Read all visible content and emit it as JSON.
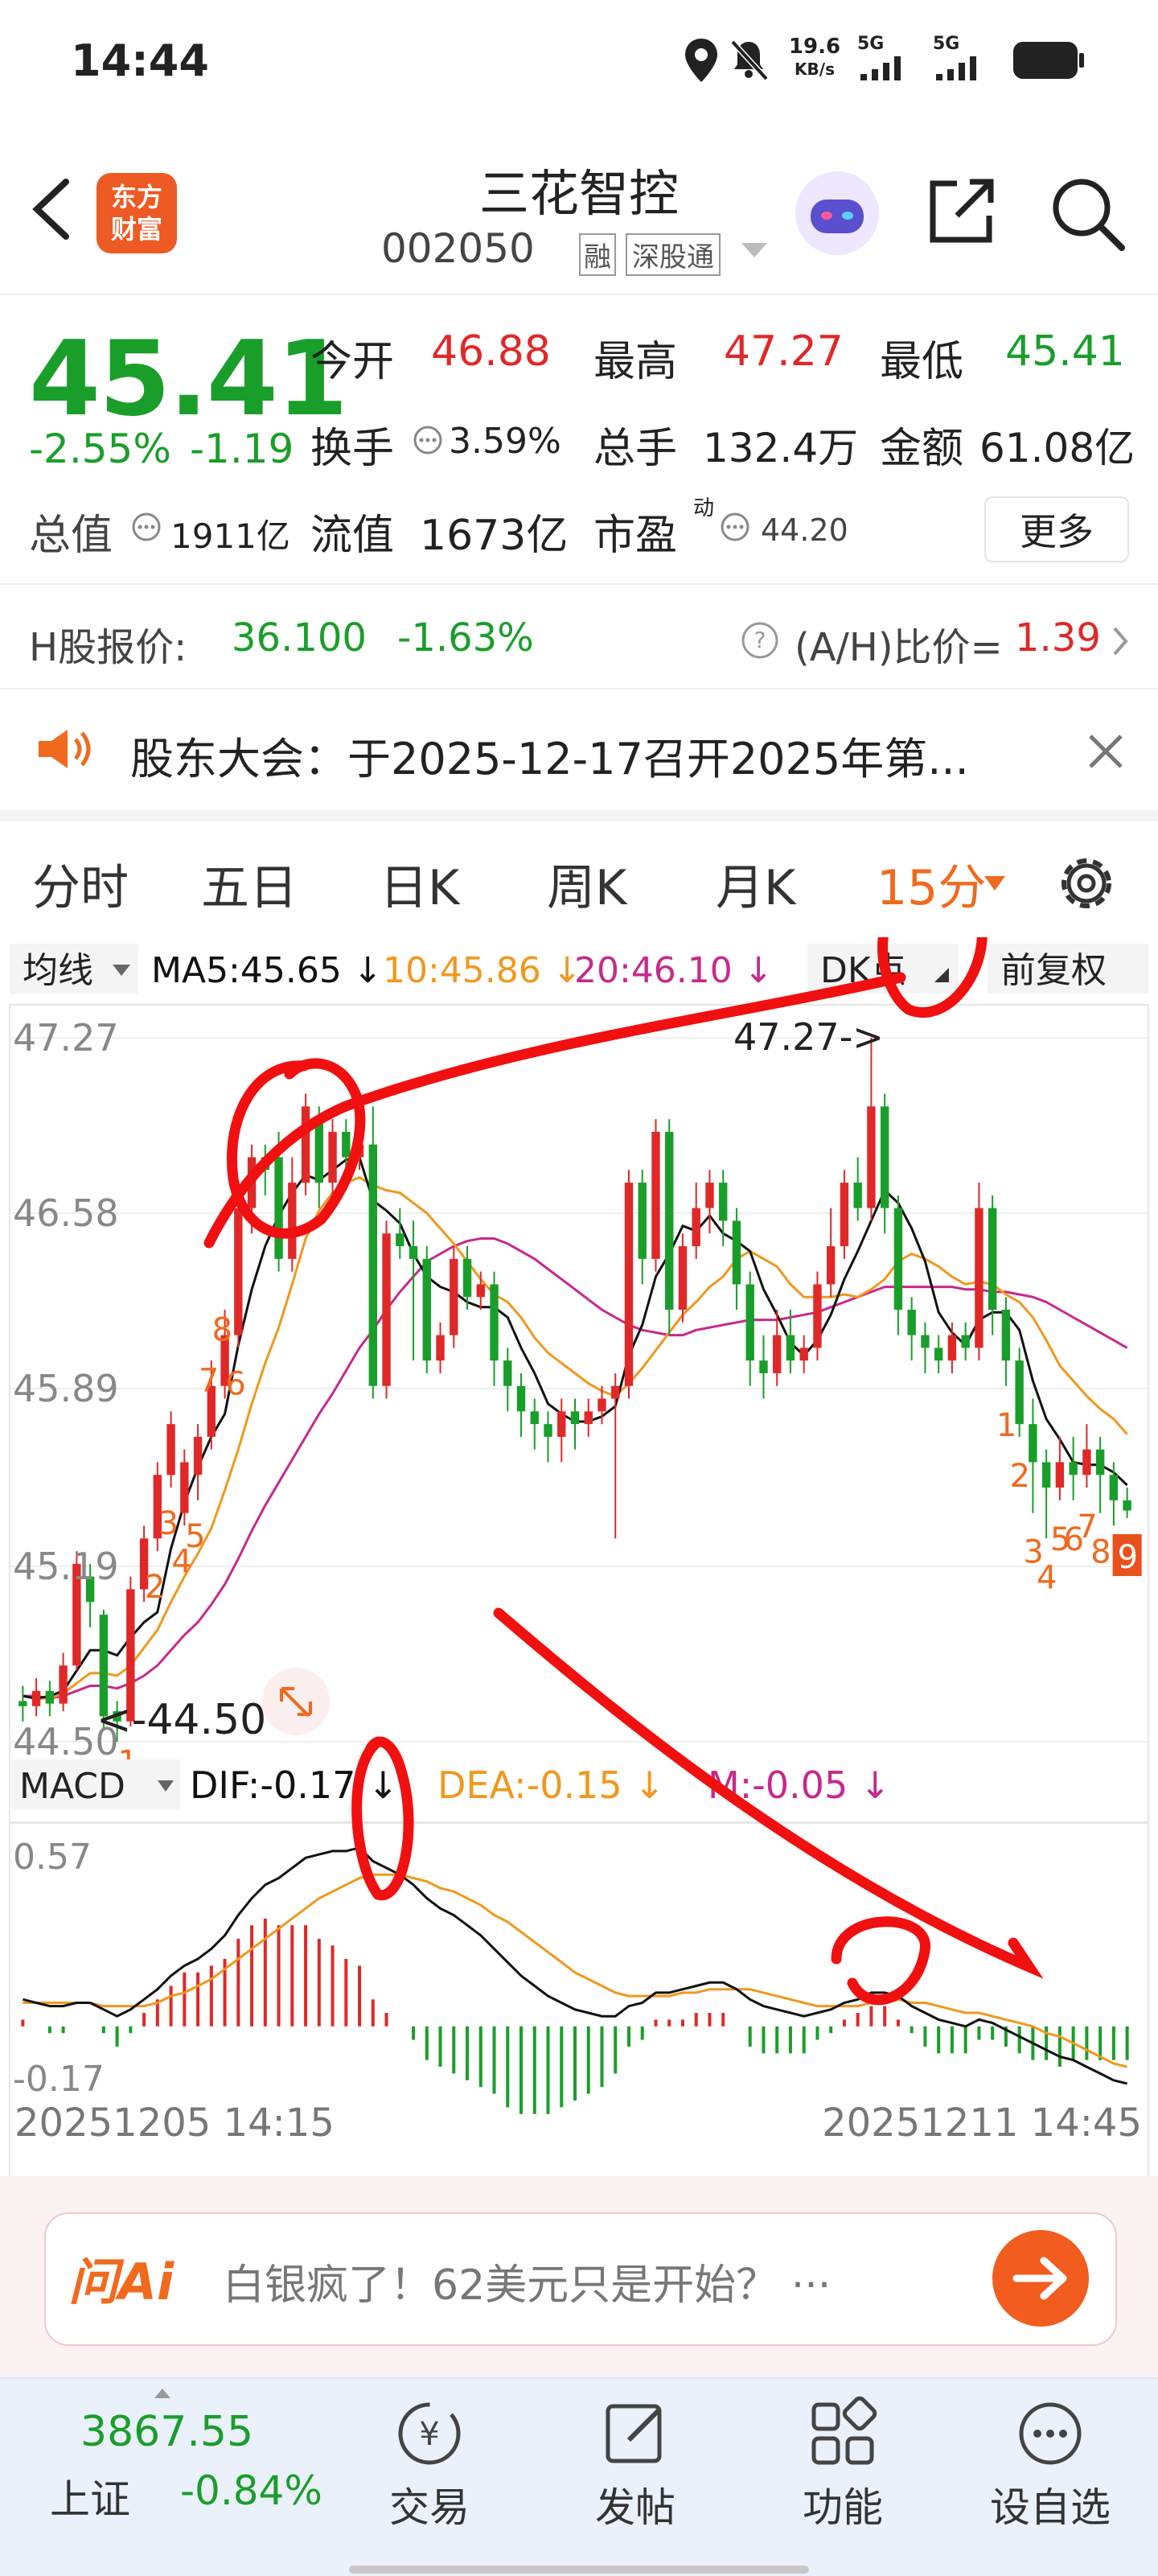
{
  "status_bar": {
    "time": "14:44",
    "net_speed_value": "19.6",
    "net_speed_unit": "KB/s",
    "sim1": "5G",
    "sim2": "5G"
  },
  "header": {
    "back_icon": "chevron-left-icon",
    "logo_line1": "东方",
    "logo_line2": "财富",
    "stock_name": "三花智控",
    "stock_code": "002050",
    "tag_margin": "融",
    "tag_connect": "深股通"
  },
  "quote": {
    "price": "45.41",
    "change_pct": "-2.55%",
    "change": "-1.19",
    "open_label": "今开",
    "open": "46.88",
    "high_label": "最高",
    "high": "47.27",
    "low_label": "最低",
    "low": "45.41",
    "turnover_label": "换手",
    "turnover": "3.59%",
    "volume_label": "总手",
    "volume": "132.4万",
    "amount_label": "金额",
    "amount": "61.08亿",
    "mktcap_label": "总值",
    "mktcap": "1911亿",
    "float_label": "流值",
    "float": "1673亿",
    "pe_label": "市盈",
    "pe_sup": "动",
    "pe": "44.20",
    "more": "更多"
  },
  "hshare": {
    "label": "H股报价:",
    "price": "36.100",
    "pct": "-1.63%",
    "ratio_label": "(A/H)比价=",
    "ratio": "1.39"
  },
  "notice": {
    "text": "股东大会：于2025-12-17召开2025年第..."
  },
  "tabs": [
    "分时",
    "五日",
    "日K",
    "周K",
    "月K",
    "15分"
  ],
  "ma_bar": {
    "selector": "均线",
    "ma5": "MA5:45.65 ↓",
    "ma10": "10:45.86 ↓",
    "ma20": "20:46.10 ↓",
    "dk": "DK点",
    "fq": "前复权"
  },
  "macd_bar": {
    "selector": "MACD",
    "dif": "DIF:-0.17 ↓",
    "dea": "DEA:-0.15 ↓",
    "m": "M:-0.05 ↓"
  },
  "colors": {
    "up": "#e02828",
    "down": "#1a9e2a",
    "ma5": "#111111",
    "ma10": "#f0981e",
    "ma20": "#c8288c"
  },
  "chart_data": {
    "type": "candlestick",
    "y_ticks": [
      "47.27",
      "46.58",
      "45.89",
      "45.19",
      "44.50"
    ],
    "ylim": [
      44.5,
      47.27
    ],
    "high_annotation": "47.27->",
    "low_annotation": "<-44.50",
    "macd_ticks": [
      "0.57",
      "-0.17"
    ],
    "macd_ylim": [
      -0.17,
      0.57
    ],
    "x_start": "20251205 14:15",
    "x_end": "20251211 14:45",
    "markers_up": [
      "7",
      "8",
      "6",
      "2",
      "3",
      "4",
      "5",
      "1"
    ],
    "markers_down": [
      "1",
      "2",
      "3",
      "4",
      "5",
      "6",
      "7",
      "8",
      "9"
    ],
    "candles": [
      [
        44.66,
        44.64,
        44.72,
        44.58
      ],
      [
        44.64,
        44.7,
        44.75,
        44.6
      ],
      [
        44.7,
        44.65,
        44.74,
        44.6
      ],
      [
        44.65,
        44.8,
        44.85,
        44.62
      ],
      [
        44.8,
        45.2,
        45.25,
        44.78
      ],
      [
        45.15,
        45.05,
        45.2,
        44.95
      ],
      [
        45.0,
        44.6,
        45.02,
        44.55
      ],
      [
        44.62,
        44.58,
        44.66,
        44.5
      ],
      [
        44.58,
        45.1,
        45.15,
        44.56
      ],
      [
        45.1,
        45.3,
        45.35,
        45.05
      ],
      [
        45.3,
        45.55,
        45.6,
        45.25
      ],
      [
        45.55,
        45.75,
        45.8,
        45.5
      ],
      [
        45.4,
        45.6,
        45.65,
        45.35
      ],
      [
        45.55,
        45.7,
        45.75,
        45.45
      ],
      [
        45.7,
        45.9,
        46.0,
        45.65
      ],
      [
        45.9,
        46.1,
        46.2,
        45.85
      ],
      [
        46.1,
        46.6,
        46.7,
        46.05
      ],
      [
        46.6,
        46.8,
        46.85,
        46.5
      ],
      [
        46.8,
        46.75,
        46.85,
        46.65
      ],
      [
        46.8,
        46.4,
        46.9,
        46.35
      ],
      [
        46.4,
        46.7,
        46.8,
        46.35
      ],
      [
        46.7,
        47.0,
        47.05,
        46.65
      ],
      [
        46.95,
        46.7,
        47.0,
        46.6
      ],
      [
        46.7,
        46.9,
        46.95,
        46.65
      ],
      [
        46.9,
        46.8,
        46.95,
        46.7
      ],
      [
        46.8,
        46.85,
        47.0,
        46.75
      ],
      [
        46.85,
        45.9,
        47.0,
        45.85
      ],
      [
        45.9,
        46.5,
        46.55,
        45.85
      ],
      [
        46.5,
        46.45,
        46.6,
        46.4
      ],
      [
        46.45,
        46.4,
        46.55,
        46.0
      ],
      [
        46.4,
        46.0,
        46.45,
        45.95
      ],
      [
        46.0,
        46.1,
        46.15,
        45.95
      ],
      [
        46.1,
        46.4,
        46.45,
        46.05
      ],
      [
        46.4,
        46.25,
        46.45,
        46.2
      ],
      [
        46.25,
        46.3,
        46.35,
        46.2
      ],
      [
        46.3,
        46.0,
        46.35,
        45.9
      ],
      [
        46.0,
        45.9,
        46.05,
        45.8
      ],
      [
        45.9,
        45.8,
        45.95,
        45.7
      ],
      [
        45.8,
        45.75,
        45.85,
        45.65
      ],
      [
        45.75,
        45.7,
        45.8,
        45.6
      ],
      [
        45.7,
        45.8,
        45.85,
        45.6
      ],
      [
        45.8,
        45.75,
        45.85,
        45.65
      ],
      [
        45.75,
        45.8,
        45.85,
        45.7
      ],
      [
        45.8,
        45.85,
        45.9,
        45.75
      ],
      [
        45.85,
        45.9,
        45.95,
        45.3
      ],
      [
        45.9,
        46.7,
        46.75,
        45.85
      ],
      [
        46.7,
        46.4,
        46.75,
        46.3
      ],
      [
        46.4,
        46.9,
        46.95,
        46.35
      ],
      [
        46.9,
        46.2,
        46.95,
        46.1
      ],
      [
        46.2,
        46.45,
        46.5,
        46.15
      ],
      [
        46.45,
        46.6,
        46.7,
        46.4
      ],
      [
        46.6,
        46.7,
        46.75,
        46.5
      ],
      [
        46.7,
        46.55,
        46.75,
        46.45
      ],
      [
        46.55,
        46.3,
        46.6,
        46.2
      ],
      [
        46.3,
        46.0,
        46.35,
        45.9
      ],
      [
        46.0,
        45.95,
        46.1,
        45.85
      ],
      [
        45.95,
        46.1,
        46.2,
        45.9
      ],
      [
        46.1,
        46.0,
        46.2,
        45.95
      ],
      [
        46.0,
        46.05,
        46.1,
        45.95
      ],
      [
        46.05,
        46.3,
        46.35,
        46.0
      ],
      [
        46.3,
        46.45,
        46.6,
        46.25
      ],
      [
        46.45,
        46.7,
        46.75,
        46.4
      ],
      [
        46.7,
        46.6,
        46.8,
        46.55
      ],
      [
        46.6,
        47.0,
        47.27,
        46.55
      ],
      [
        47.0,
        46.6,
        47.05,
        46.5
      ],
      [
        46.6,
        46.2,
        46.65,
        46.1
      ],
      [
        46.2,
        46.1,
        46.25,
        46.0
      ],
      [
        46.1,
        46.05,
        46.15,
        45.95
      ],
      [
        46.05,
        46.0,
        46.1,
        45.95
      ],
      [
        46.0,
        46.1,
        46.15,
        45.95
      ],
      [
        46.1,
        46.05,
        46.15,
        46.0
      ],
      [
        46.05,
        46.6,
        46.7,
        46.0
      ],
      [
        46.6,
        46.2,
        46.65,
        46.1
      ],
      [
        46.2,
        46.0,
        46.25,
        45.9
      ],
      [
        46.0,
        45.75,
        46.05,
        45.7
      ],
      [
        45.75,
        45.6,
        45.85,
        45.4
      ],
      [
        45.6,
        45.5,
        45.65,
        45.3
      ],
      [
        45.5,
        45.6,
        45.7,
        45.45
      ],
      [
        45.6,
        45.55,
        45.7,
        45.45
      ],
      [
        45.55,
        45.65,
        45.75,
        45.5
      ],
      [
        45.65,
        45.55,
        45.7,
        45.4
      ],
      [
        45.55,
        45.45,
        45.6,
        45.35
      ],
      [
        45.45,
        45.41,
        45.5,
        45.38
      ]
    ],
    "ma5": [
      44.68,
      44.67,
      44.68,
      44.7,
      44.78,
      44.86,
      44.86,
      44.84,
      44.91,
      44.97,
      45.01,
      45.26,
      45.44,
      45.58,
      45.7,
      45.79,
      46.06,
      46.28,
      46.45,
      46.57,
      46.66,
      46.73,
      46.71,
      46.75,
      46.79,
      46.8,
      46.63,
      46.59,
      46.54,
      46.42,
      46.33,
      46.29,
      46.27,
      46.23,
      46.21,
      46.21,
      46.17,
      46.05,
      45.95,
      45.83,
      45.79,
      45.76,
      45.76,
      45.78,
      45.82,
      46.02,
      46.14,
      46.33,
      46.42,
      46.53,
      46.51,
      46.57,
      46.5,
      46.47,
      46.43,
      46.28,
      46.18,
      46.07,
      46.02,
      46.08,
      46.18,
      46.32,
      46.43,
      46.55,
      46.67,
      46.62,
      46.52,
      46.39,
      46.19,
      46.11,
      46.06,
      46.16,
      46.19,
      46.19,
      46.12,
      45.92,
      45.77,
      45.69,
      45.6,
      45.59,
      45.59,
      45.56,
      45.51
    ],
    "ma10": [
      44.68,
      44.67,
      44.67,
      44.69,
      44.73,
      44.77,
      44.77,
      44.76,
      44.8,
      44.87,
      44.94,
      45.05,
      45.15,
      45.24,
      45.34,
      45.49,
      45.65,
      45.83,
      45.99,
      46.13,
      46.3,
      46.48,
      46.59,
      46.66,
      46.7,
      46.72,
      46.69,
      46.67,
      46.66,
      46.62,
      46.58,
      46.52,
      46.46,
      46.39,
      46.32,
      46.26,
      46.23,
      46.17,
      46.09,
      46.03,
      45.99,
      45.95,
      45.91,
      45.88,
      45.86,
      45.91,
      45.97,
      46.04,
      46.11,
      46.18,
      46.23,
      46.29,
      46.33,
      46.4,
      46.43,
      46.4,
      46.37,
      46.3,
      46.25,
      46.25,
      46.25,
      46.26,
      46.25,
      46.28,
      46.32,
      46.39,
      46.42,
      46.4,
      46.37,
      46.33,
      46.3,
      46.31,
      46.3,
      46.26,
      46.23,
      46.17,
      46.08,
      45.98,
      45.92,
      45.86,
      45.81,
      45.77,
      45.71
    ],
    "ma20": [
      44.68,
      44.68,
      44.67,
      44.68,
      44.7,
      44.72,
      44.72,
      44.71,
      44.73,
      44.76,
      44.8,
      44.86,
      44.92,
      44.97,
      45.04,
      45.12,
      45.22,
      45.33,
      45.43,
      45.52,
      45.61,
      45.7,
      45.79,
      45.87,
      45.96,
      46.05,
      46.12,
      46.2,
      46.27,
      46.33,
      46.39,
      46.42,
      46.45,
      46.47,
      46.48,
      46.48,
      46.46,
      46.43,
      46.4,
      46.36,
      46.32,
      46.28,
      46.24,
      46.2,
      46.17,
      46.14,
      46.12,
      46.11,
      46.1,
      46.1,
      46.12,
      46.13,
      46.14,
      46.15,
      46.16,
      46.16,
      46.16,
      46.17,
      46.18,
      46.19,
      46.21,
      46.23,
      46.25,
      46.27,
      46.29,
      46.29,
      46.29,
      46.29,
      46.29,
      46.29,
      46.28,
      46.28,
      46.27,
      46.27,
      46.26,
      46.25,
      46.23,
      46.2,
      46.17,
      46.14,
      46.11,
      46.08,
      46.05
    ],
    "dif": [
      0.08,
      0.07,
      0.06,
      0.06,
      0.07,
      0.07,
      0.05,
      0.03,
      0.05,
      0.08,
      0.11,
      0.15,
      0.18,
      0.2,
      0.23,
      0.27,
      0.33,
      0.38,
      0.42,
      0.44,
      0.47,
      0.5,
      0.51,
      0.52,
      0.52,
      0.53,
      0.49,
      0.47,
      0.45,
      0.42,
      0.38,
      0.35,
      0.33,
      0.3,
      0.27,
      0.23,
      0.19,
      0.15,
      0.12,
      0.09,
      0.07,
      0.05,
      0.04,
      0.03,
      0.03,
      0.06,
      0.07,
      0.1,
      0.1,
      0.11,
      0.12,
      0.13,
      0.13,
      0.11,
      0.08,
      0.06,
      0.05,
      0.04,
      0.03,
      0.04,
      0.05,
      0.07,
      0.08,
      0.1,
      0.1,
      0.09,
      0.06,
      0.04,
      0.02,
      0.01,
      0.0,
      0.02,
      0.01,
      -0.01,
      -0.03,
      -0.05,
      -0.07,
      -0.09,
      -0.1,
      -0.12,
      -0.14,
      -0.16,
      -0.17
    ],
    "dea": [
      0.07,
      0.07,
      0.07,
      0.07,
      0.07,
      0.07,
      0.06,
      0.06,
      0.06,
      0.06,
      0.07,
      0.09,
      0.1,
      0.12,
      0.14,
      0.17,
      0.2,
      0.23,
      0.26,
      0.29,
      0.32,
      0.35,
      0.38,
      0.4,
      0.42,
      0.44,
      0.45,
      0.45,
      0.45,
      0.44,
      0.43,
      0.41,
      0.4,
      0.38,
      0.36,
      0.33,
      0.31,
      0.28,
      0.25,
      0.22,
      0.19,
      0.16,
      0.14,
      0.12,
      0.1,
      0.09,
      0.09,
      0.09,
      0.09,
      0.1,
      0.1,
      0.11,
      0.11,
      0.11,
      0.11,
      0.1,
      0.09,
      0.08,
      0.07,
      0.06,
      0.06,
      0.06,
      0.06,
      0.07,
      0.07,
      0.08,
      0.07,
      0.07,
      0.06,
      0.05,
      0.04,
      0.04,
      0.03,
      0.02,
      0.01,
      0.0,
      -0.02,
      -0.03,
      -0.05,
      -0.07,
      -0.09,
      -0.11,
      -0.12
    ]
  },
  "ai_bar": {
    "logo": "问Ai",
    "text": "白银疯了！62美元只是开始？ ···"
  },
  "bottom_nav": {
    "index_value": "3867.55",
    "index_name": "上证",
    "index_change": "-0.84%",
    "items": [
      "交易",
      "发帖",
      "功能",
      "设自选"
    ]
  }
}
